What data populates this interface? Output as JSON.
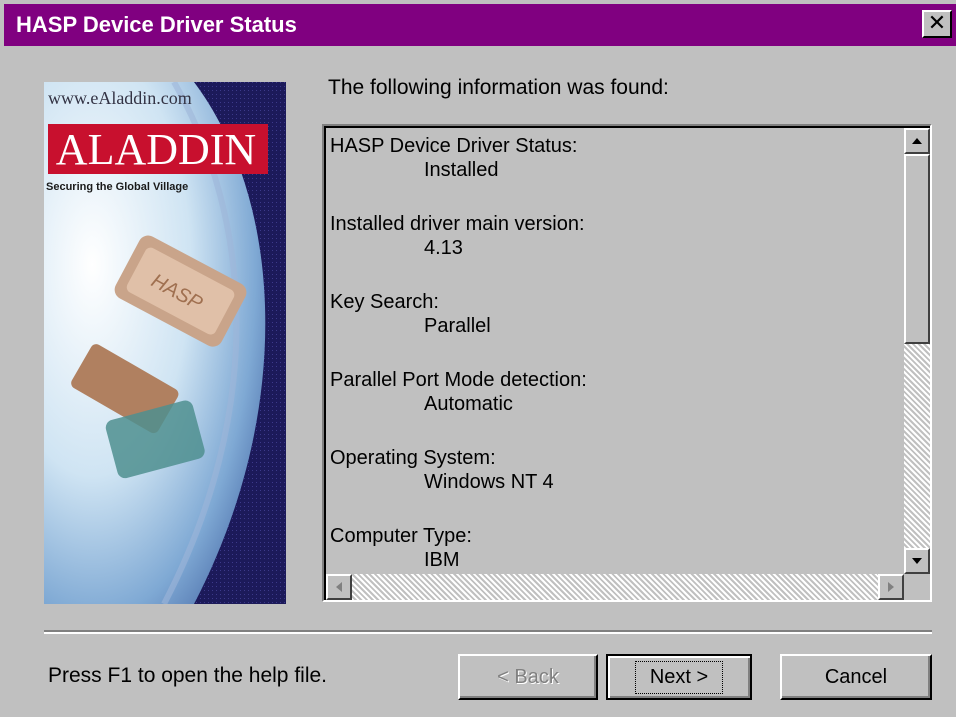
{
  "window": {
    "title": "HASP Device Driver Status",
    "close_icon": "close-icon",
    "accent_color": "#800080"
  },
  "sidebar_image": {
    "url_text": "www.eAladdin.com",
    "brand": "ALADDIN",
    "tagline": "Securing the Global Village",
    "key_label": "HASP"
  },
  "main": {
    "found_label": "The following information was found:",
    "entries": [
      {
        "label": "HASP Device Driver Status:",
        "value": "Installed"
      },
      {
        "label": "Installed driver main version:",
        "value": "4.13"
      },
      {
        "label": "Key Search:",
        "value": "Parallel"
      },
      {
        "label": "Parallel Port Mode detection:",
        "value": "Automatic"
      },
      {
        "label": "Operating System:",
        "value": "Windows NT 4"
      },
      {
        "label": "Computer Type:",
        "value": "IBM"
      }
    ]
  },
  "footer": {
    "help_text": "Press F1 to open the help file.",
    "back_label": "< Back",
    "next_label": "Next >",
    "cancel_label": "Cancel"
  }
}
